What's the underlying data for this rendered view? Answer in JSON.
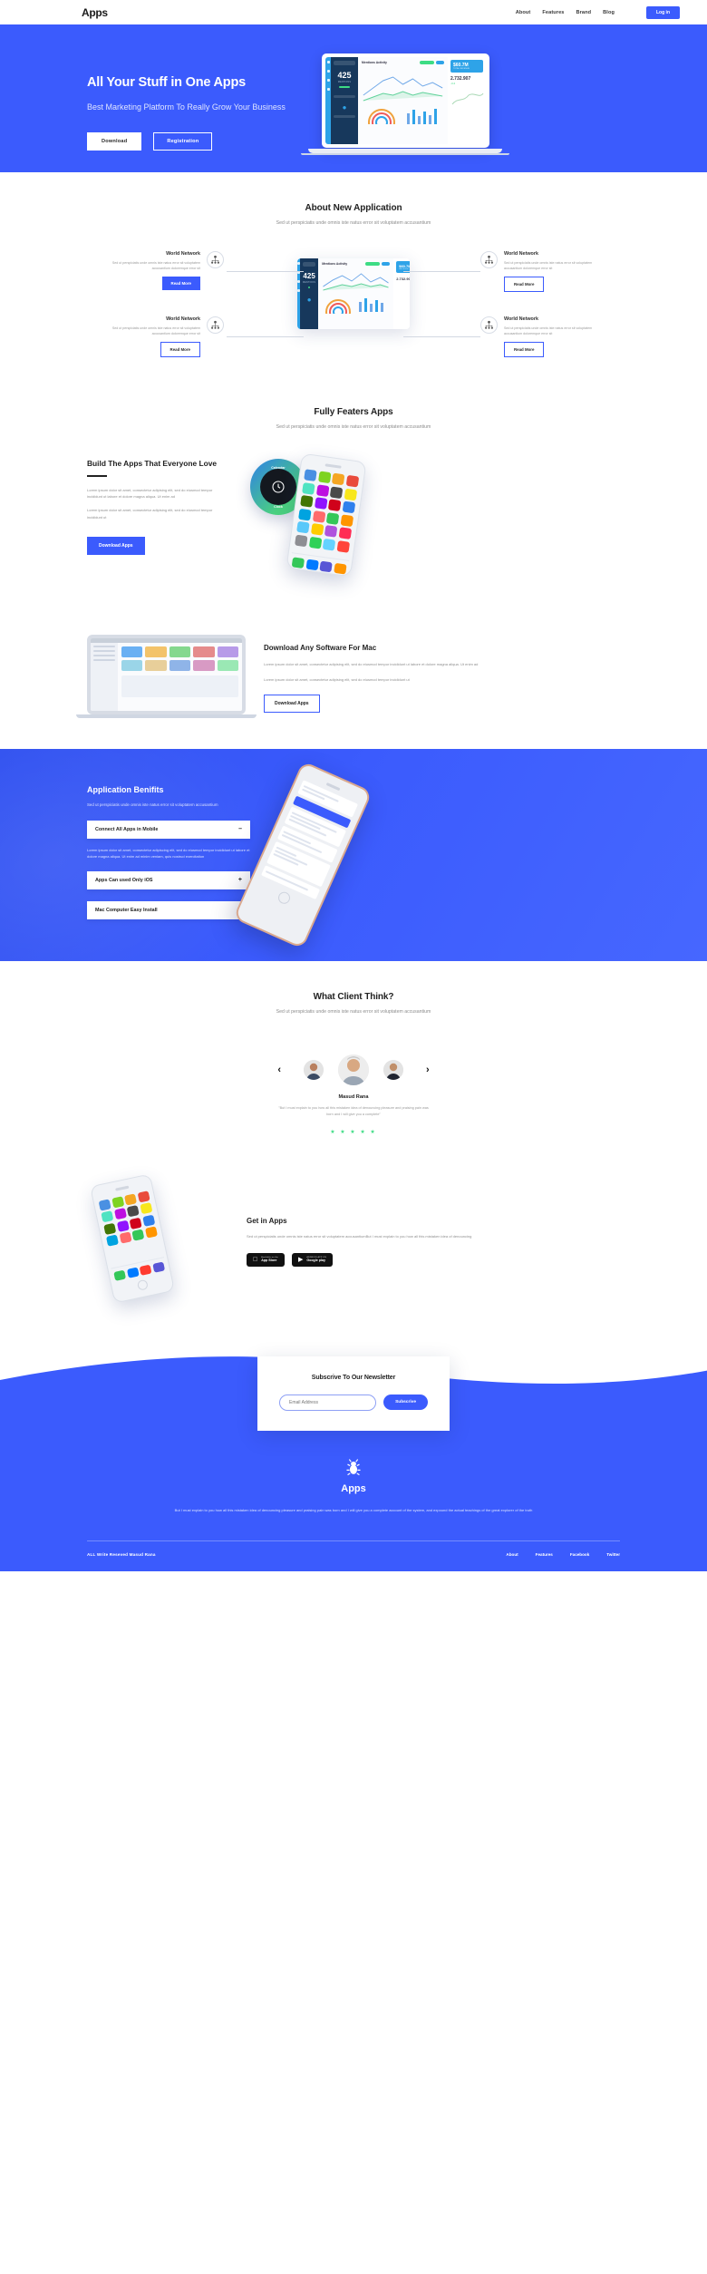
{
  "header": {
    "logo": "Apps",
    "nav": [
      {
        "label": "About"
      },
      {
        "label": "Features"
      },
      {
        "label": "Brand"
      },
      {
        "label": "Blog"
      }
    ],
    "login_label": "Log in"
  },
  "hero": {
    "title": "All Your Stuff in One Apps",
    "subtitle": "Best Marketing Platform To Really Grow Your Business",
    "btn_download": "Download",
    "btn_registration": "Registration",
    "dashboard": {
      "metric_value": "425",
      "metric_label": "MENTIONS",
      "chart_title": "Mentions Activity",
      "kpi_value": "$60.7M",
      "kpi_label": "TOTAL REVENUE",
      "kpi2_value": "2.732.907",
      "kpi2_delta": "-3.2"
    }
  },
  "about": {
    "title": "About New Application",
    "subtitle": "Sed ut perspiciatis unde omnis iste natus error sit voluptatem accusantium",
    "features": [
      {
        "title": "World Network",
        "body": "Sed ut perspiciatis unde omnis iste natus error sit voluptatem accusantium doloremque error sit",
        "button": "Read More",
        "icon": "network-icon"
      },
      {
        "title": "World Network",
        "body": "Sed ut perspiciatis unde omnis iste natus error sit voluptatem accusantium doloremque error sit",
        "button": "Read More",
        "icon": "network-icon"
      },
      {
        "title": "World Network",
        "body": "Sed ut perspiciatis unde omnis iste natus error sit voluptatem accusantium doloremque error sit",
        "button": "Read More",
        "icon": "network-icon"
      },
      {
        "title": "World Network",
        "body": "Sed ut perspiciatis unde omnis iste natus error sit voluptatem accusantium doloremque error sit",
        "button": "Read More",
        "icon": "network-icon"
      }
    ]
  },
  "features": {
    "title": "Fully Featers Apps",
    "subtitle": "Sed ut perspiciatis unde omnis iste natus error sit voluptatem accusantium",
    "build_title": "Build The Apps That Everyone Love",
    "build_p1": "Lorem ipsum dolor sit amet, consectetur adipising elit, sed do eiusmod tempor incididunt ut labore et dolore magna aliqua. Ut enim ad",
    "build_p2": "Lorem ipsum dolor sit amet, consectetur adipising elit, sed do eiusmod tempor incididunt ut",
    "build_button": "Download Apps",
    "watch_label_top": "Calendar",
    "watch_label_bottom": "Clock"
  },
  "mac": {
    "title": "Download Any Software For Mac",
    "p1": "Lorem ipsum dolor sit amet, consectetur adipising elit, sed do eiusmod tempor incididunt ut labore et dolore magna aliqua. Ut enim ad",
    "p2": "Lorem ipsum dolor sit amet, consectetur adipising elit, sed do eiusmod tempor incididunt ut",
    "button": "Download Apps"
  },
  "benefits": {
    "title": "Application Benifits",
    "subtitle": "Sed ut perspiciatis unde omnis iste natus error sit voluptatem accusantium",
    "items": [
      {
        "label": "Connect All Apps in Mobile",
        "sign": "–",
        "open": true,
        "body": "Lorem ipsum dolor sit amet, consectetur adipiscing elit, sed do eiusmod tempor incididunt ut labore et dolore magna aliqua. Ut enim ad minim veniam, quis nostrud exercitation"
      },
      {
        "label": "Apps Can used Only iOS",
        "sign": "+",
        "open": false,
        "body": ""
      },
      {
        "label": "Mac Computer Easy Install",
        "sign": "+",
        "open": false,
        "body": ""
      }
    ]
  },
  "testimonial": {
    "title": "What Client Think?",
    "subtitle": "Sed ut perspiciatis unde omnis iste natus error sit voluptatem accusantium",
    "prev_icon": "‹",
    "next_icon": "›",
    "name": "Masud Rana",
    "quote": "\"But I must explain to you how all this mistaken idea of denouncing pleasure and praising pain was born and I will give you a complete\"",
    "stars": "★ ★ ★ ★ ★"
  },
  "getin": {
    "title": "Get in Apps",
    "body": "Sed ut perspiciatis unde omnis iste natus error sit voluptatem accusantiumBut I must explain to you how all this mistaken idea of denouncing",
    "stores": [
      {
        "small": "Available on the",
        "big": "App Store",
        "icon": "apple-icon"
      },
      {
        "small": "ANDROID APP ON",
        "big": "Google play",
        "icon": "play-icon"
      }
    ]
  },
  "newsletter": {
    "title": "Subscrive To Our Newsletter",
    "input_placeholder": "Email Address",
    "button": "Subscrive"
  },
  "footer": {
    "logo_icon": "bug-icon",
    "logo_name": "Apps",
    "text": "But I must explain to you how all this mistaken idea of denouncing pleasure and praising pain was born and I will give you a complete account of the system, and expound the actual teachings of the great explorer of the truth",
    "copyright": "ALL Write Reseved Masud Rana",
    "links": [
      {
        "label": "About"
      },
      {
        "label": "Features"
      },
      {
        "label": "Facebook"
      },
      {
        "label": "Twitter"
      }
    ]
  },
  "colors": {
    "brand": "#3b5bfd",
    "accent_green": "#3ddc84",
    "dark": "#17385c"
  }
}
